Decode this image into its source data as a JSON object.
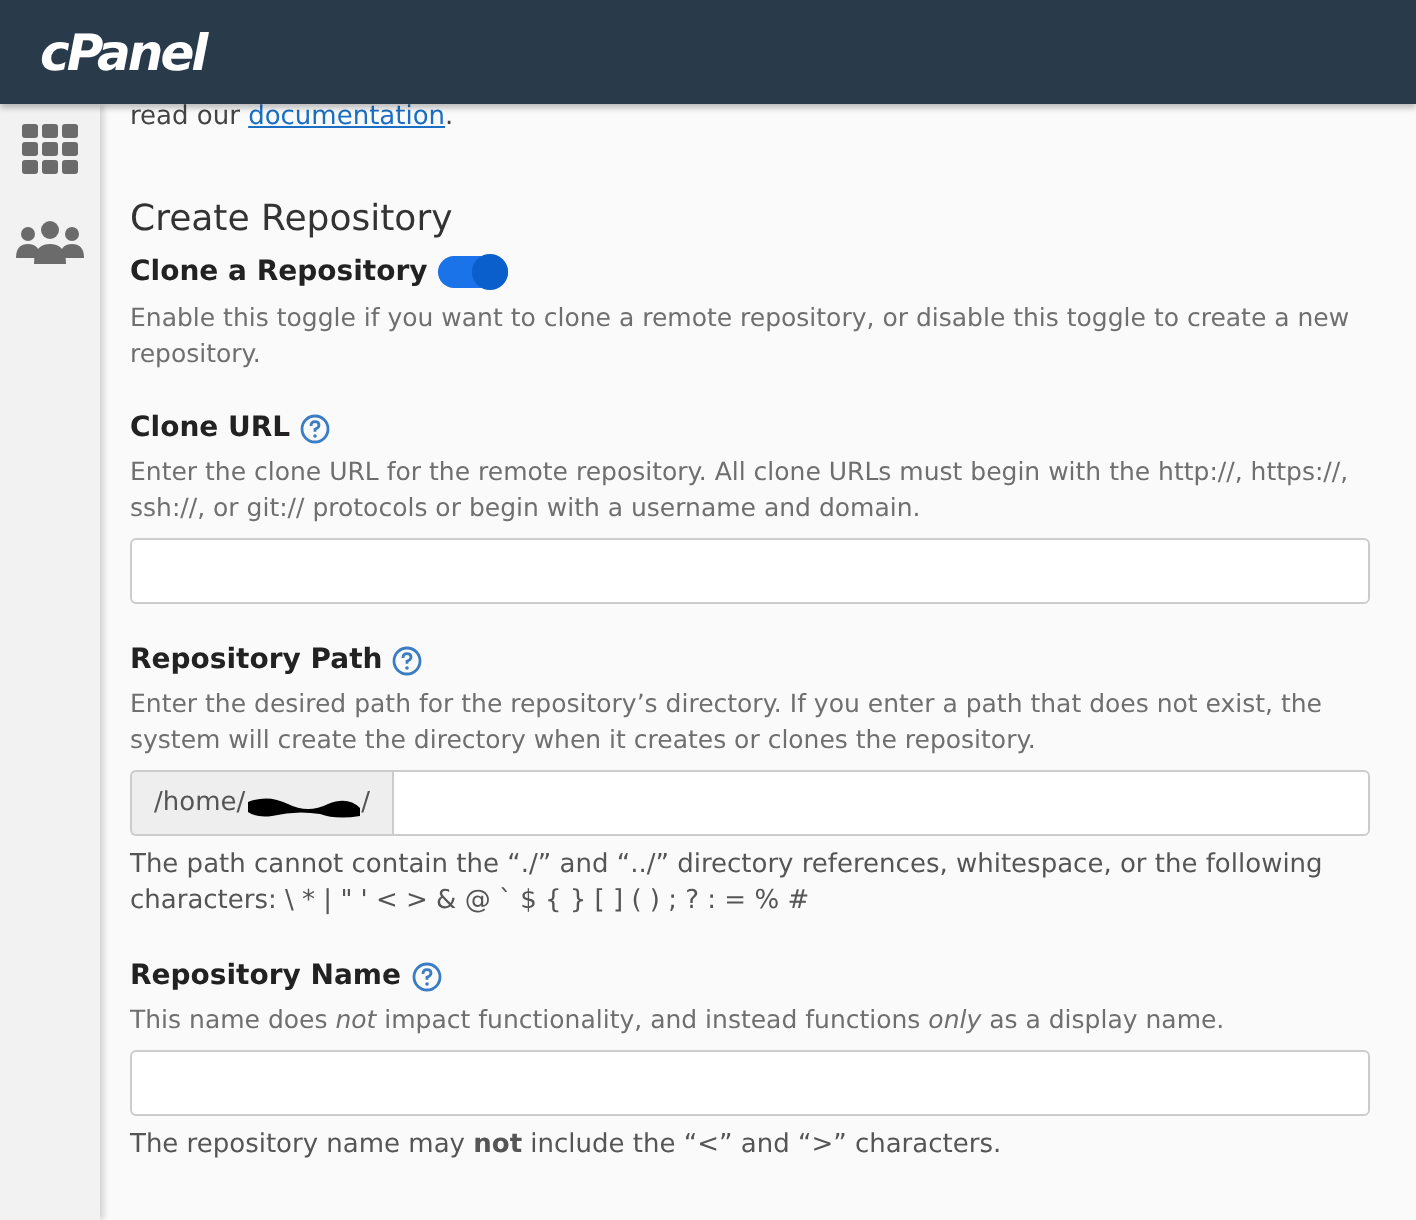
{
  "header": {
    "logo": "cPanel"
  },
  "intro": {
    "text": "read our",
    "link": "documentation",
    "after": "."
  },
  "section_title": "Create Repository",
  "clone_toggle": {
    "label": "Clone a Repository",
    "on": true,
    "description": "Enable this toggle if you want to clone a remote repository, or disable this toggle to create a new repository."
  },
  "fields": [
    {
      "kind": "text",
      "label": "Clone URL",
      "description": "Enter the clone URL for the remote repository. All clone URLs must begin with the http://, https://, ssh://, or git:// protocols or begin with a username and domain."
    },
    {
      "kind": "prefixed",
      "label": "Repository Path",
      "description": "Enter the desired path for the repository’s directory. If you enter a path that does not exist, the system will create the directory when it creates or clones the repository.",
      "prefix": "/home/",
      "redacted": true,
      "prefix_tail": "/",
      "note": "The path cannot contain the “./” and “../” directory references, whitespace, or the following characters: \\ * | \" ' < > & @ ` $ { } [ ] ( ) ; ? : = % #"
    },
    {
      "kind": "text",
      "label": "Repository Name",
      "description": "This name does *not* impact functionality, and instead functions *only* as a display name.",
      "note": "The repository name may **not** include the “<” and “>” characters."
    }
  ]
}
